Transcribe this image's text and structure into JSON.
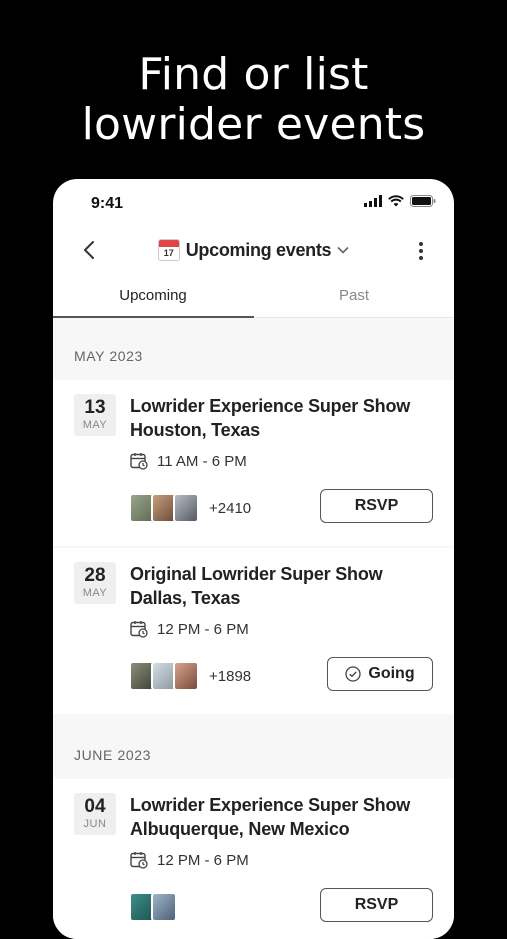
{
  "hero": {
    "line1": "Find or list",
    "line2": "lowrider events"
  },
  "status_bar": {
    "time": "9:41"
  },
  "nav": {
    "calendar_emoji_day": "17",
    "title": "Upcoming events"
  },
  "tabs": [
    {
      "label": "Upcoming",
      "active": true
    },
    {
      "label": "Past",
      "active": false
    }
  ],
  "sections": [
    {
      "header": "MAY 2023",
      "events": [
        {
          "day": "13",
          "month": "MAY",
          "title_line1": "Lowrider Experience Super Show",
          "title_line2": "Houston, Texas",
          "time": "11 AM - 6 PM",
          "attendees": "+2410",
          "button": "RSVP"
        },
        {
          "day": "28",
          "month": "MAY",
          "title_line1": "Original Lowrider Super Show",
          "title_line2": "Dallas, Texas",
          "time": "12 PM - 6 PM",
          "attendees": "+1898",
          "button": "Going"
        }
      ]
    },
    {
      "header": "JUNE 2023",
      "events": [
        {
          "day": "04",
          "month": "JUN",
          "title_line1": "Lowrider Experience Super Show",
          "title_line2": "Albuquerque, New Mexico",
          "time": "12 PM - 6 PM",
          "button": "RSVP"
        }
      ]
    }
  ],
  "colors": {
    "background": "#000000",
    "card": "#ffffff",
    "list_bg": "#f7f7f7",
    "calendar_red": "#e04646"
  }
}
